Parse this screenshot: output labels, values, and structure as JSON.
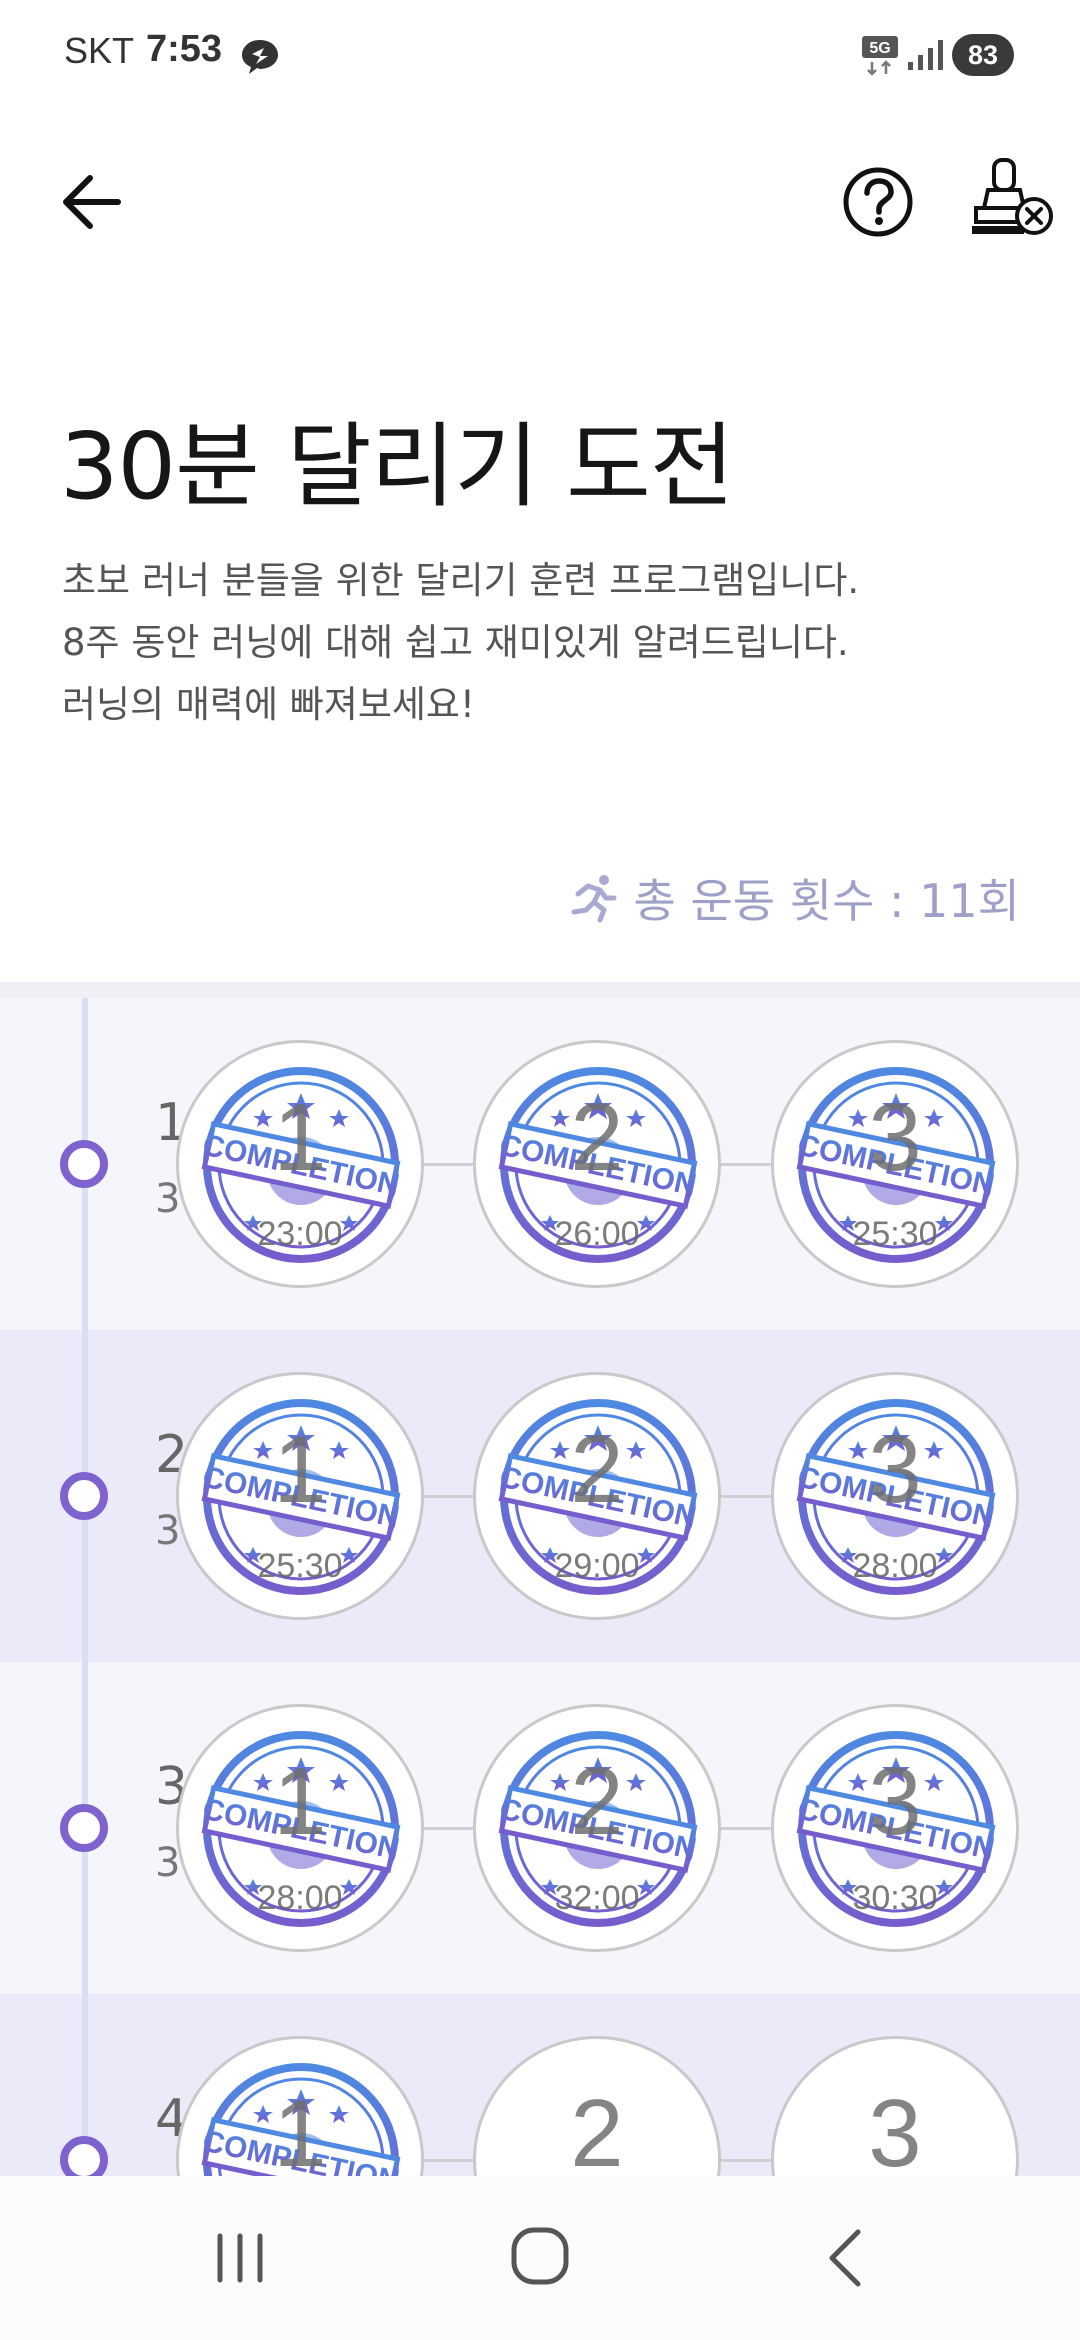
{
  "status_bar": {
    "carrier": "SKT",
    "time": "7:53",
    "network": "5G",
    "battery": "83"
  },
  "app_bar": {
    "back_icon": "arrow-left-icon",
    "help_icon": "question-circle-icon",
    "stamp_icon": "stamp-cancel-icon"
  },
  "program": {
    "title": "30분 달리기 도전",
    "description": [
      "초보 러너 분들을 위한 달리기 훈련 프로그램입니다.",
      "8주 동안 러닝에 대해 쉽고 재미있게 알려드립니다.",
      "러닝의 매력에 빠져보세요!"
    ],
    "total_label": "총 운동 횟수 : 11회"
  },
  "weeks": [
    {
      "label": "1",
      "sub": "3",
      "sessions": [
        {
          "number": "1",
          "time": "23:00",
          "completed": true
        },
        {
          "number": "2",
          "time": "26:00",
          "completed": true
        },
        {
          "number": "3",
          "time": "25:30",
          "completed": true
        }
      ]
    },
    {
      "label": "2",
      "sub": "3",
      "sessions": [
        {
          "number": "1",
          "time": "25:30",
          "completed": true
        },
        {
          "number": "2",
          "time": "29:00",
          "completed": true
        },
        {
          "number": "3",
          "time": "28:00",
          "completed": true
        }
      ]
    },
    {
      "label": "3",
      "sub": "3",
      "sessions": [
        {
          "number": "1",
          "time": "28:00",
          "completed": true
        },
        {
          "number": "2",
          "time": "32:00",
          "completed": true
        },
        {
          "number": "3",
          "time": "30:30",
          "completed": true
        }
      ]
    },
    {
      "label": "4",
      "sub": "",
      "sessions": [
        {
          "number": "1",
          "time": "",
          "completed": true
        },
        {
          "number": "2",
          "time": "",
          "completed": false
        },
        {
          "number": "3",
          "time": "",
          "completed": false
        }
      ]
    }
  ],
  "stamp_text": "COMPLETION",
  "colors": {
    "accent": "#7e63cf",
    "stamp_blue": "#3f7fe0",
    "stamp_purple": "#6b4fc9",
    "count_text": "#9fa0c8"
  }
}
